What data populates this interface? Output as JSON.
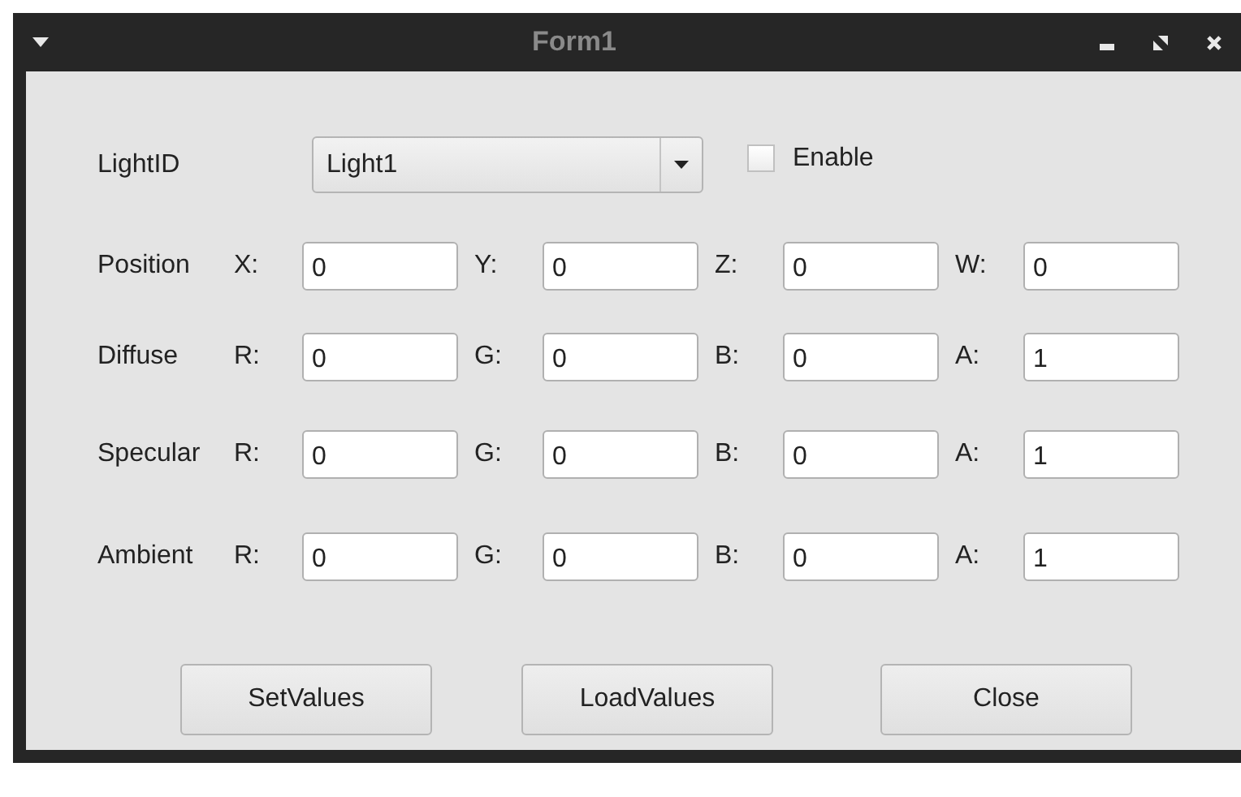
{
  "window": {
    "title": "Form1"
  },
  "light_id": {
    "label": "LightID",
    "value": "Light1"
  },
  "enable": {
    "label": "Enable",
    "checked": false
  },
  "rows": [
    {
      "label": "Position",
      "fields": [
        {
          "label": "X:",
          "value": "0"
        },
        {
          "label": "Y:",
          "value": "0"
        },
        {
          "label": "Z:",
          "value": "0"
        },
        {
          "label": "W:",
          "value": "0"
        }
      ]
    },
    {
      "label": "Diffuse",
      "fields": [
        {
          "label": "R:",
          "value": "0"
        },
        {
          "label": "G:",
          "value": "0"
        },
        {
          "label": "B:",
          "value": "0"
        },
        {
          "label": "A:",
          "value": "1"
        }
      ]
    },
    {
      "label": "Specular",
      "fields": [
        {
          "label": "R:",
          "value": "0"
        },
        {
          "label": "G:",
          "value": "0"
        },
        {
          "label": "B:",
          "value": "0"
        },
        {
          "label": "A:",
          "value": "1"
        }
      ]
    },
    {
      "label": "Ambient",
      "fields": [
        {
          "label": "R:",
          "value": "0"
        },
        {
          "label": "G:",
          "value": "0"
        },
        {
          "label": "B:",
          "value": "0"
        },
        {
          "label": "A:",
          "value": "1"
        }
      ]
    }
  ],
  "buttons": [
    "SetValues",
    "LoadValues",
    "Close"
  ]
}
